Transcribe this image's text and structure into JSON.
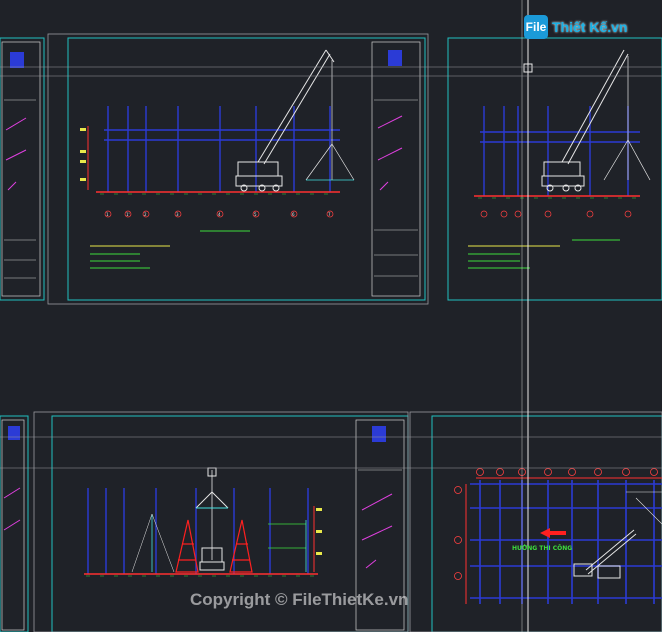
{
  "watermark": {
    "logo_mark": "File",
    "logo_text": "Thiết Kế.vn",
    "copyright": "Copyright © FileThietKe.vn"
  },
  "drawing": {
    "direction_label": "HƯỚNG THI CÔNG",
    "axis_labels": [
      "1",
      "1'",
      "2",
      "3",
      "4",
      "5",
      "6",
      "7"
    ]
  },
  "colors": {
    "background": "#1f2228",
    "frame": "#20c0c0",
    "grid_blue": "#2b3bd6",
    "crane": "#e6e6e6",
    "dim_red": "#ff3030",
    "dim_green": "#3ddc3d",
    "yellow": "#e8e84a"
  }
}
